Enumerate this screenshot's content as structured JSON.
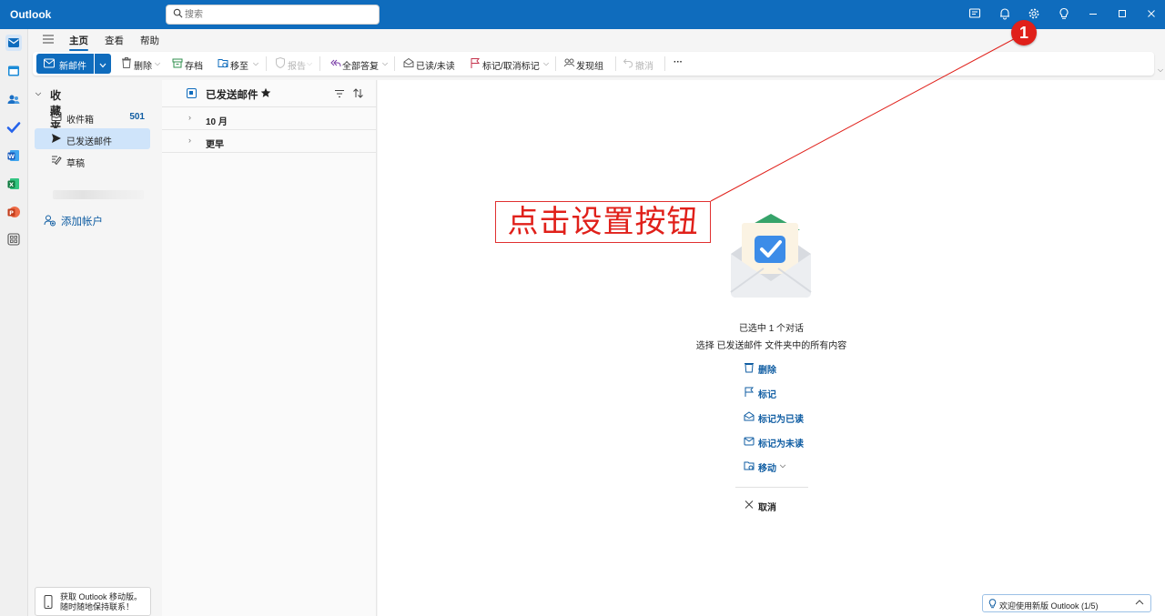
{
  "window": {
    "app_title": "Outlook"
  },
  "search": {
    "placeholder": "搜索"
  },
  "ribbon": {
    "tabs": [
      {
        "label": "主页",
        "active": true
      },
      {
        "label": "查看",
        "active": false
      },
      {
        "label": "帮助",
        "active": false
      }
    ],
    "new_mail": "新邮件",
    "delete": "删除",
    "archive": "存档",
    "move_to": "移至",
    "report": "报告",
    "reply_all": "全部答复",
    "read_unread": "已读/未读",
    "flag_unflag": "标记/取消标记",
    "discover_groups": "发现组",
    "undo": "撤消",
    "more": "···"
  },
  "folders": {
    "favorites": "收藏夹",
    "items": [
      {
        "label": "收件箱",
        "count": "501",
        "selected": false,
        "icon": "inbox-icon"
      },
      {
        "label": "已发送邮件",
        "count": "",
        "selected": true,
        "icon": "send-icon"
      },
      {
        "label": "草稿",
        "count": "",
        "selected": false,
        "icon": "draft-icon"
      }
    ],
    "add_account": "添加帐户",
    "mobile_promo_line1": "获取 Outlook 移动版。",
    "mobile_promo_line2": "随时随地保持联系！"
  },
  "message_list": {
    "title": "已发送邮件",
    "groups": [
      "10 月",
      "更早"
    ]
  },
  "reading_pane": {
    "selected_count_text": "已选中 1 个对话",
    "select_all_text": "选择 已发送邮件 文件夹中的所有内容",
    "actions": {
      "delete": "删除",
      "flag": "标记",
      "mark_read": "标记为已读",
      "mark_unread": "标记为未读",
      "move": "移动",
      "cancel": "取消"
    },
    "tip": "欢迎使用新版 Outlook (1/5)"
  },
  "annotation": {
    "label": "点击设置按钮",
    "number": "1",
    "color": "#e0201a"
  },
  "colors": {
    "brand": "#0f6cbd",
    "selected_folder": "#cfe4fa"
  }
}
